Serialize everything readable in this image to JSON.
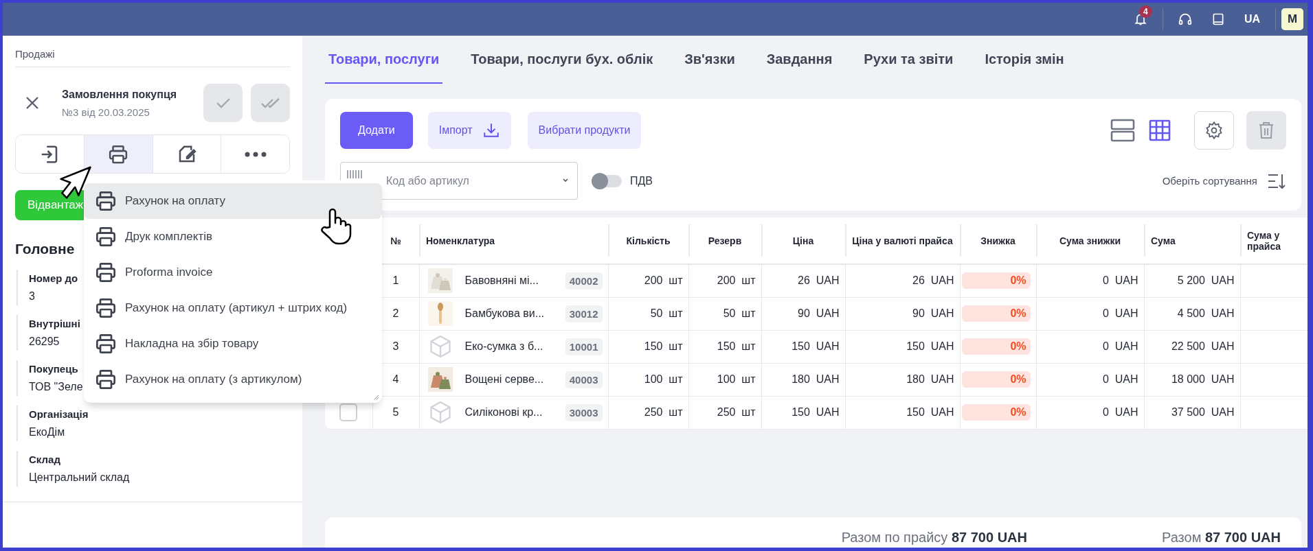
{
  "topbar": {
    "notifications": "4",
    "language": "UA",
    "avatar": "M"
  },
  "sidebar": {
    "breadcrumb": "Продажі",
    "title": "Замовлення покупця",
    "subtitle": "№3 від 20.03.2025",
    "actions": [
      {
        "kind": "enter",
        "selected": false
      },
      {
        "kind": "print",
        "selected": true
      },
      {
        "kind": "edit",
        "selected": false
      },
      {
        "kind": "more",
        "selected": false
      }
    ],
    "ship_button": "Відвантаж",
    "section": "Головне",
    "fields": [
      {
        "label": "Номер до",
        "value": "3"
      },
      {
        "label": "Внутрішні",
        "value": "26295"
      },
      {
        "label": "Покупець",
        "value": "ТОВ \"Зеле"
      },
      {
        "label": "Організація",
        "value": "ЕкоДім"
      },
      {
        "label": "Склад",
        "value": "Центральний склад"
      }
    ]
  },
  "print_menu": {
    "items": [
      {
        "label": "Рахунок на оплату",
        "selected": true
      },
      {
        "label": "Друк комплектів",
        "selected": false
      },
      {
        "label": "Proforma invoice",
        "selected": false
      },
      {
        "label": "Рахунок на оплату (артикул + штрих код)",
        "selected": false
      },
      {
        "label": "Накладна на збір товару",
        "selected": false
      },
      {
        "label": "Рахунок на оплату (з артикулом)",
        "selected": false
      }
    ]
  },
  "tabs": [
    {
      "label": "Товари, послуги",
      "selected": true
    },
    {
      "label": "Товари, послуги бух. облік",
      "selected": false
    },
    {
      "label": "Зв'язки",
      "selected": false
    },
    {
      "label": "Завдання",
      "selected": false
    },
    {
      "label": "Рухи та звіти",
      "selected": false
    },
    {
      "label": "Історія змін",
      "selected": false
    }
  ],
  "toolbar": {
    "add": "Додати",
    "import": "Імпорт",
    "pick": "Вибрати продукти",
    "views": [
      {
        "kind": "rows",
        "selected": false
      },
      {
        "kind": "grid",
        "selected": true
      }
    ],
    "search": {
      "placeholder": "Код або артикул"
    },
    "vat": {
      "label": "ПДВ",
      "on": false
    },
    "sort": "Оберіть сортування"
  },
  "table": {
    "columns": [
      "№",
      "Номенклатура",
      "Кількість",
      "Резерв",
      "Ціна",
      "Ціна у валюті прайса",
      "Знижка",
      "Сума знижки",
      "Сума",
      "Сума у прайса"
    ],
    "rows": [
      {
        "no": "1",
        "kind": "picture",
        "name": "Бавовняні мі...",
        "code": "40002",
        "quantity": [
          "200",
          "шт"
        ],
        "reserve": [
          "200",
          "шт"
        ],
        "price": [
          "26",
          "UAH"
        ],
        "list_price": [
          "26",
          "UAH"
        ],
        "discount": "0%",
        "discount_sum": [
          "0",
          "UAH"
        ],
        "sum": [
          "5 200",
          "UAH"
        ]
      },
      {
        "no": "2",
        "kind": "picture",
        "name": "Бамбукова ви...",
        "code": "30012",
        "quantity": [
          "50",
          "шт"
        ],
        "reserve": [
          "50",
          "шт"
        ],
        "price": [
          "90",
          "UAH"
        ],
        "list_price": [
          "90",
          "UAH"
        ],
        "discount": "0%",
        "discount_sum": [
          "0",
          "UAH"
        ],
        "sum": [
          "4 500",
          "UAH"
        ]
      },
      {
        "no": "3",
        "kind": "placeholder",
        "name": "Еко-сумка з б...",
        "code": "10001",
        "quantity": [
          "150",
          "шт"
        ],
        "reserve": [
          "150",
          "шт"
        ],
        "price": [
          "150",
          "UAH"
        ],
        "list_price": [
          "150",
          "UAH"
        ],
        "discount": "0%",
        "discount_sum": [
          "0",
          "UAH"
        ],
        "sum": [
          "22 500",
          "UAH"
        ]
      },
      {
        "no": "4",
        "kind": "picture",
        "name": "Вощені серве...",
        "code": "40003",
        "quantity": [
          "100",
          "шт"
        ],
        "reserve": [
          "100",
          "шт"
        ],
        "price": [
          "180",
          "UAH"
        ],
        "list_price": [
          "180",
          "UAH"
        ],
        "discount": "0%",
        "discount_sum": [
          "0",
          "UAH"
        ],
        "sum": [
          "18 000",
          "UAH"
        ]
      },
      {
        "no": "5",
        "checked": false,
        "kind": "placeholder",
        "name": "Силіконові кр...",
        "code": "30003",
        "quantity": [
          "250",
          "шт"
        ],
        "reserve": [
          "250",
          "шт"
        ],
        "price": [
          "150",
          "UAH"
        ],
        "list_price": [
          "150",
          "UAH"
        ],
        "discount": "0%",
        "discount_sum": [
          "0",
          "UAH"
        ],
        "sum": [
          "37 500",
          "UAH"
        ]
      }
    ]
  },
  "totals": [
    "Разом по прайсу **87 700 UAH**",
    "Разом **87 700 UAH**"
  ]
}
